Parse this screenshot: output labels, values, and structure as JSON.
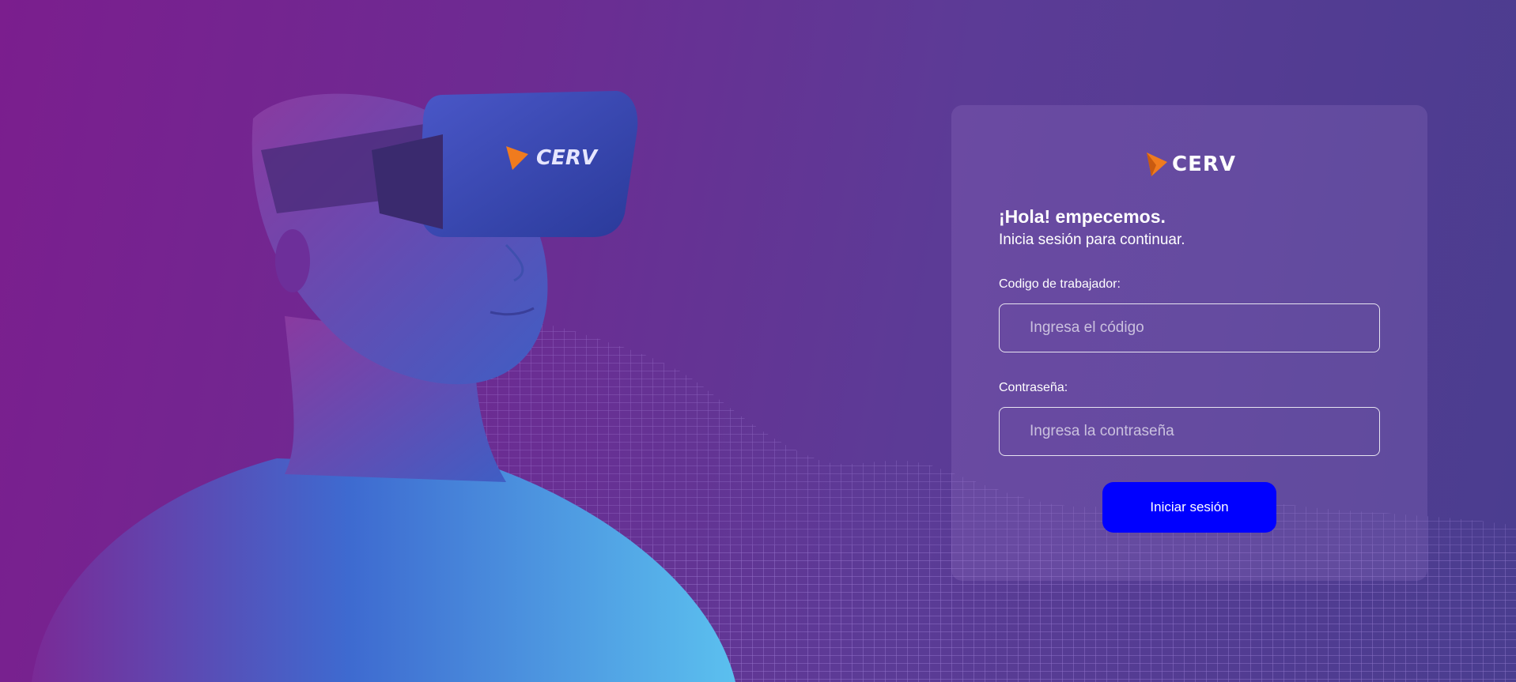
{
  "brand": {
    "name": "CERV",
    "logo_icon": "play-triangle-icon",
    "logo_color": "#f07b1e"
  },
  "hero": {
    "headset_logo_text": "CERV"
  },
  "login": {
    "greeting": "¡Hola! empecemos.",
    "subtitle": "Inicia sesión para continuar.",
    "code_label": "Codigo de trabajador:",
    "code_placeholder": "Ingresa el código",
    "code_value": "",
    "password_label": "Contraseña:",
    "password_placeholder": "Ingresa la contraseña",
    "password_value": "",
    "submit_label": "Iniciar sesión"
  },
  "colors": {
    "button": "#0000ff",
    "background_start": "#7b1e8e",
    "background_end": "#4a3d8f"
  }
}
